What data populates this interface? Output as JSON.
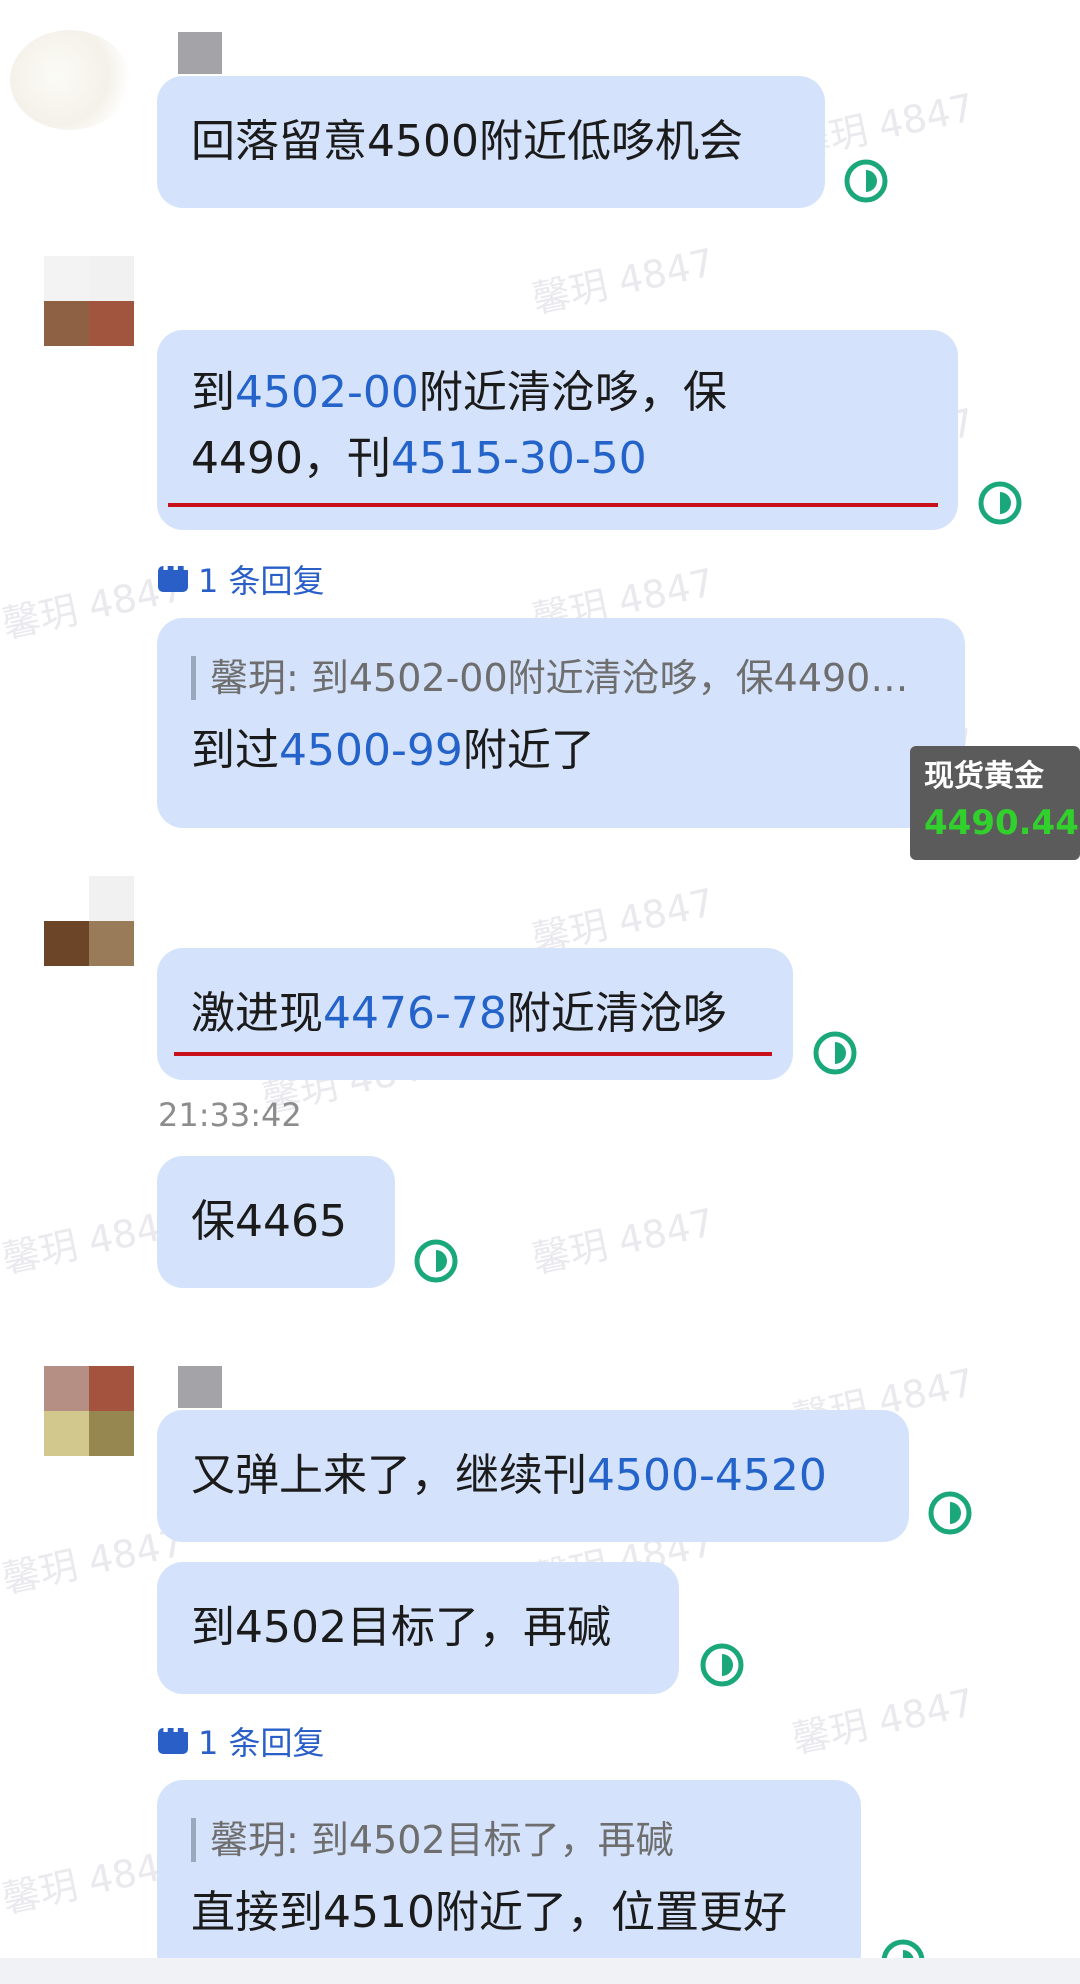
{
  "watermark": "馨玥 4847",
  "messages": {
    "m1": "回落留意4500附近低哆机会",
    "m2_a": "到",
    "m2_b": "4502-00",
    "m2_c": "附近清沧哆，保",
    "m2_d": "4490，刊",
    "m2_e": "4515-30-50",
    "reply1_label": "1 条回复",
    "quote1": "馨玥: 到4502-00附近清沧哆，保4490…",
    "r1_a": "到过",
    "r1_b": "4500-99",
    "r1_c": "附近了",
    "m3_a": "激进现",
    "m3_b": "4476-78",
    "m3_c": "附近清沧哆",
    "time1": "21:33:42",
    "m4": "保4465",
    "m5_a": "又弹上来了，继续刊",
    "m5_b": "4500-4520",
    "m6": "到4502目标了，再碱",
    "reply2_label": "1 条回复",
    "quote2": "馨玥: 到4502目标了，再碱",
    "r2": "直接到4510附近了，位置更好"
  },
  "ticker": {
    "name": "现货黄金",
    "price": "4490.44",
    "price_color": "#31d02d"
  },
  "colors": {
    "bubble": "#d4e3fb",
    "number": "#2463c9",
    "read_icon": "#1aa87a",
    "underline": "#c8101a"
  }
}
